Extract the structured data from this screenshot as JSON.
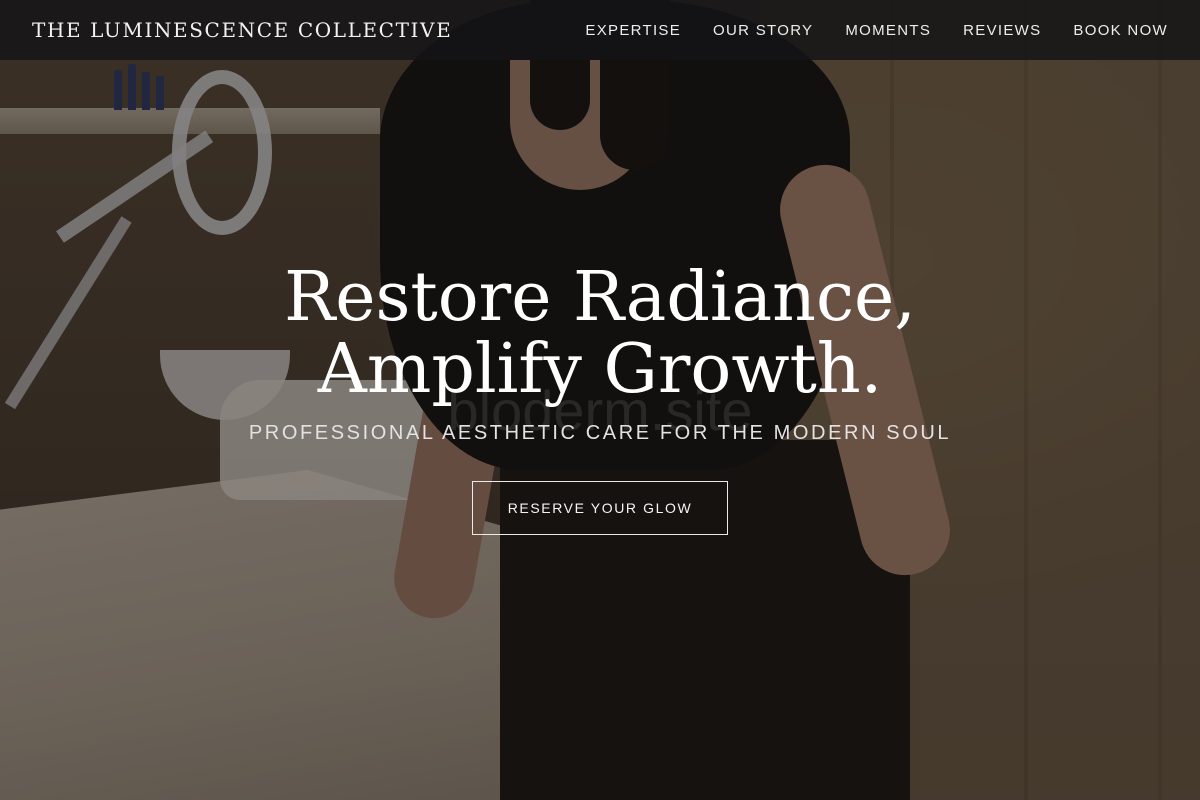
{
  "header": {
    "brand": "THE LUMINESCENCE COLLECTIVE",
    "nav": [
      {
        "label": "EXPERTISE"
      },
      {
        "label": "OUR STORY"
      },
      {
        "label": "MOMENTS"
      },
      {
        "label": "REVIEWS"
      },
      {
        "label": "BOOK NOW"
      }
    ]
  },
  "hero": {
    "headline_line1": "Restore Radiance,",
    "headline_line2": "Amplify Growth.",
    "subtitle": "PROFESSIONAL AESTHETIC CARE FOR THE MODERN SOUL",
    "cta_label": "RESERVE YOUR GLOW",
    "watermark": "bloderm.site"
  },
  "colors": {
    "header_bg": "#141416",
    "text_primary": "#ffffff",
    "overlay": "#16120f"
  }
}
